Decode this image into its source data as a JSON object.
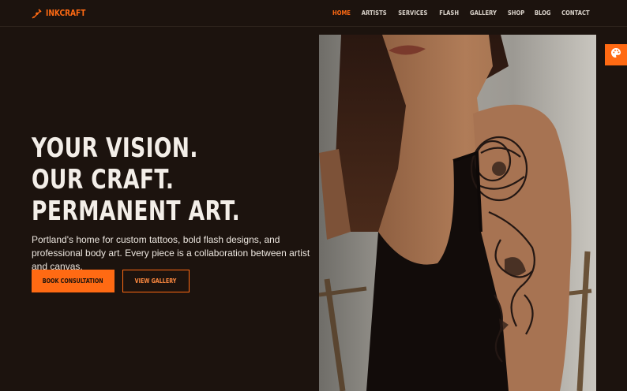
{
  "brand": {
    "name": "INKCRAFT",
    "icon": "pen-nib-icon",
    "accent": "#ff6a13"
  },
  "nav": {
    "items": [
      {
        "label": "HOME",
        "active": true
      },
      {
        "label": "ARTISTS"
      },
      {
        "label": "SERVICES"
      },
      {
        "label": "FLASH"
      },
      {
        "label": "GALLERY"
      },
      {
        "label": "SHOP"
      },
      {
        "label": "BLOG"
      },
      {
        "label": "CONTACT"
      }
    ]
  },
  "hero": {
    "heading_lines": [
      "YOUR VISION.",
      "OUR CRAFT.",
      "PERMANENT ART."
    ],
    "subtitle": "Portland's home for custom tattoos, bold flash designs, and professional body art. Every piece is a collaboration between artist and canvas.",
    "primary_cta": "BOOK CONSULTATION",
    "secondary_cta": "VIEW GALLERY",
    "image": "tattooed-woman-photo"
  },
  "side_widget": {
    "icon": "palette-icon"
  },
  "colors": {
    "background": "#1c130e",
    "accent": "#ff6a13",
    "text": "#f1ece6"
  }
}
